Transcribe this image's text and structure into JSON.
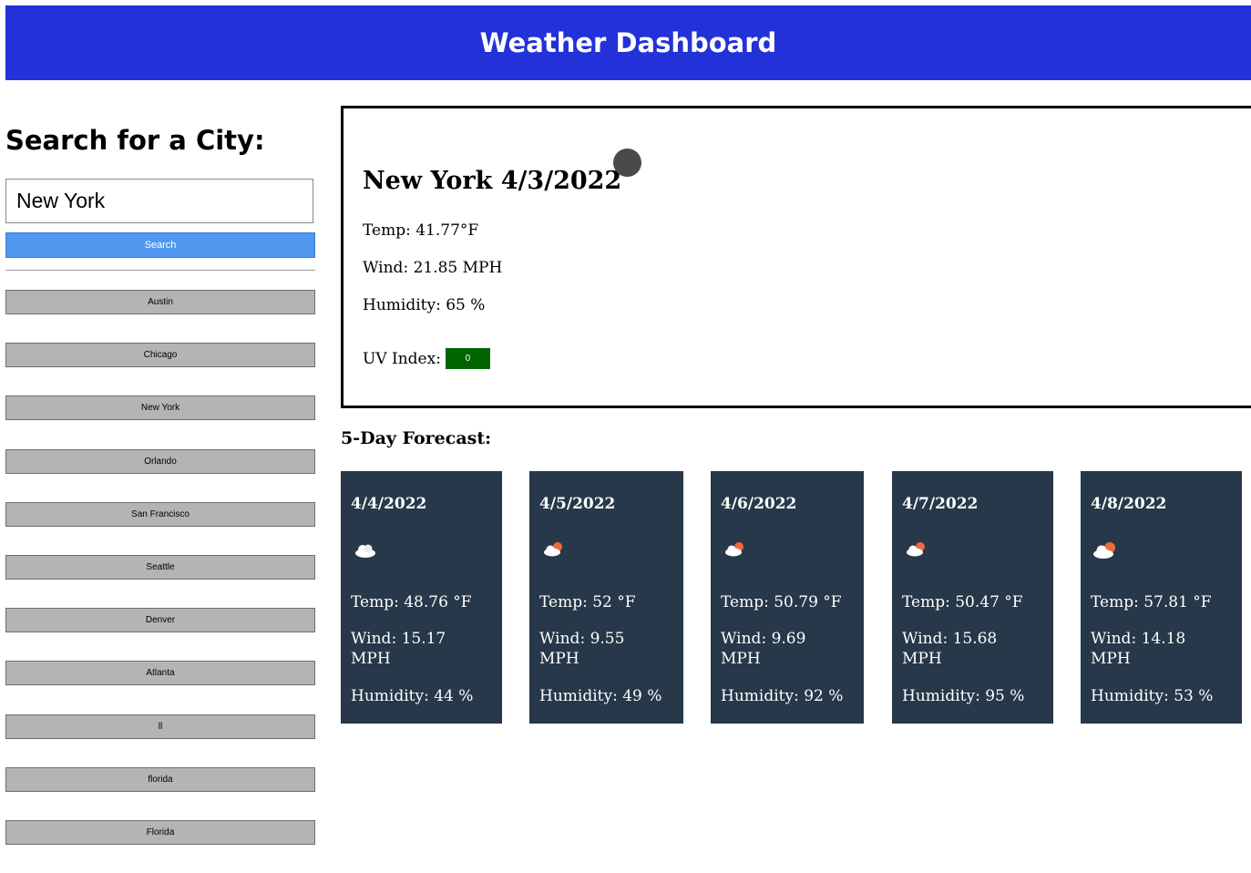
{
  "header": {
    "title": "Weather Dashboard"
  },
  "search": {
    "title": "Search for a City:",
    "input_value": "New York",
    "button_label": "Search"
  },
  "history": [
    "Austin",
    "Chicago",
    "New York",
    "Orlando",
    "San Francisco",
    "Seattle",
    "Denver",
    "Atlanta",
    "ll",
    "florida",
    "Florida"
  ],
  "current": {
    "city_date": "New York 4/3/2022",
    "icon": "circle-weather-icon",
    "temp": "Temp: 41.77°F",
    "wind": "Wind: 21.85 MPH",
    "humidity": "Humidity: 65 %",
    "uv_label": "UV Index:",
    "uv_value": "0",
    "uv_color": "#006400"
  },
  "forecast": {
    "title": "5-Day Forecast:",
    "days": [
      {
        "date": "4/4/2022",
        "icon": "cloud-icon",
        "temp": "Temp: 48.76 °F",
        "wind_1": "Wind: 15.17",
        "wind_2": "MPH",
        "humidity": "Humidity: 44 %"
      },
      {
        "date": "4/5/2022",
        "icon": "sun-behind-cloud-icon",
        "temp": "Temp: 52 °F",
        "wind_1": "Wind: 9.55",
        "wind_2": "MPH",
        "humidity": "Humidity: 49 %"
      },
      {
        "date": "4/6/2022",
        "icon": "sun-behind-cloud-icon",
        "temp": "Temp: 50.79 °F",
        "wind_1": "Wind: 9.69",
        "wind_2": "MPH",
        "humidity": "Humidity: 92 %"
      },
      {
        "date": "4/7/2022",
        "icon": "sun-behind-cloud-icon",
        "temp": "Temp: 50.47 °F",
        "wind_1": "Wind: 15.68",
        "wind_2": "MPH",
        "humidity": "Humidity: 95 %"
      },
      {
        "date": "4/8/2022",
        "icon": "sun-behind-cloud-icon",
        "temp": "Temp: 57.81 °F",
        "wind_1": "Wind: 14.18",
        "wind_2": "MPH",
        "humidity": "Humidity: 53 %"
      }
    ]
  },
  "colors": {
    "header_bg": "#2331d9",
    "search_button": "#4f97ef",
    "history_button": "#b5b3b3",
    "card_bg": "#263849"
  }
}
